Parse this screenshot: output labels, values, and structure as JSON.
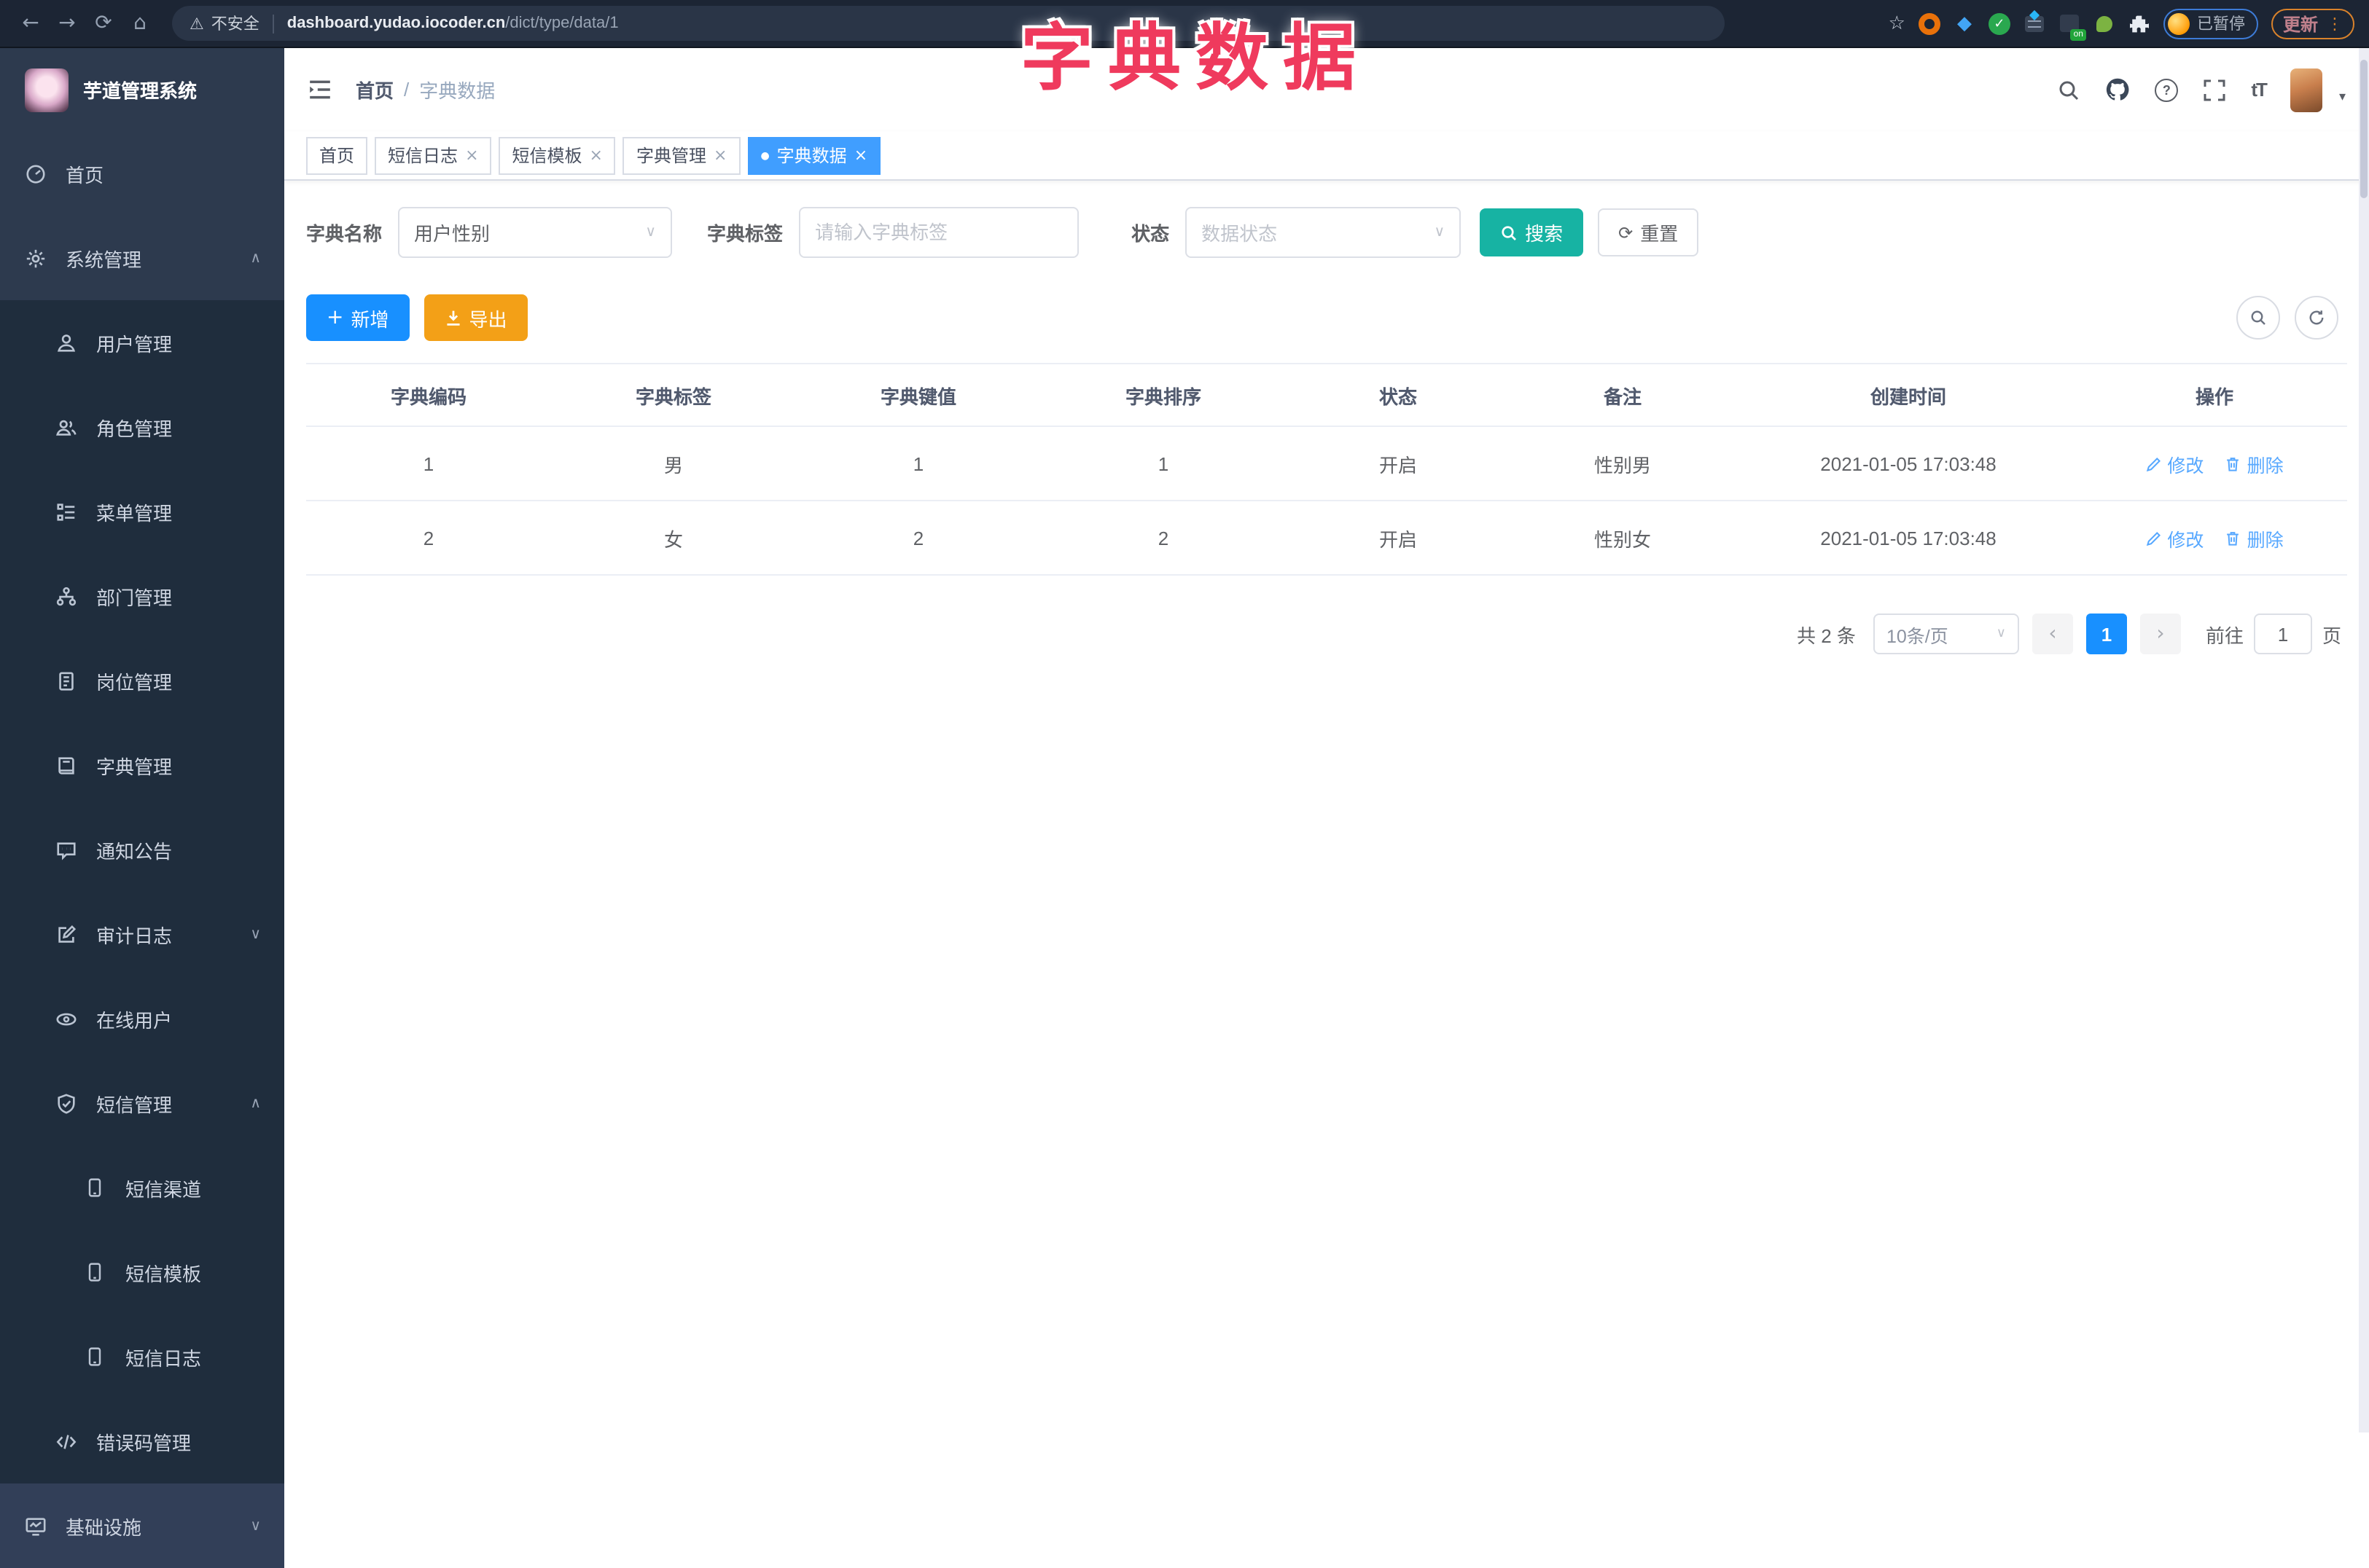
{
  "browser": {
    "security_warning": "不安全",
    "url_host": "dashboard.yudao.iocoder.cn",
    "url_path": "/dict/type/data/1",
    "paused_badge": "已暂停",
    "update_button": "更新",
    "on_badge": "on"
  },
  "overlay_title": "字典数据",
  "glyphs": {
    "back": "←",
    "forward": "→",
    "reload": "⟳",
    "home": "⌂",
    "warning": "⚠",
    "star": "☆",
    "menu_dots": "⋮",
    "close": "×",
    "active_dot": "●",
    "chevron_up": "∧",
    "chevron_down": "∨",
    "select_caret": "∨",
    "prev": "‹",
    "next": "›",
    "plus": "+",
    "refresh": "⟳",
    "caret_down": "▾",
    "question": "?",
    "font_size": "tT",
    "ext_check": "✓",
    "gem": "◆"
  },
  "sidebar": {
    "app_title": "芋道管理系统",
    "items": [
      {
        "label": "首页"
      },
      {
        "label": "系统管理"
      },
      {
        "label": "用户管理"
      },
      {
        "label": "角色管理"
      },
      {
        "label": "菜单管理"
      },
      {
        "label": "部门管理"
      },
      {
        "label": "岗位管理"
      },
      {
        "label": "字典管理"
      },
      {
        "label": "通知公告"
      },
      {
        "label": "审计日志"
      },
      {
        "label": "在线用户"
      },
      {
        "label": "短信管理"
      },
      {
        "label": "短信渠道"
      },
      {
        "label": "短信模板"
      },
      {
        "label": "短信日志"
      },
      {
        "label": "错误码管理"
      },
      {
        "label": "基础设施"
      }
    ]
  },
  "header": {
    "breadcrumb_home": "首页",
    "breadcrumb_separator": "/",
    "breadcrumb_current": "字典数据"
  },
  "tabs": [
    {
      "label": "首页"
    },
    {
      "label": "短信日志"
    },
    {
      "label": "短信模板"
    },
    {
      "label": "字典管理"
    },
    {
      "label": "字典数据"
    }
  ],
  "filters": {
    "name_label": "字典名称",
    "name_value": "用户性别",
    "tag_label": "字典标签",
    "tag_placeholder": "请输入字典标签",
    "status_label": "状态",
    "status_placeholder": "数据状态",
    "search_button": "搜索",
    "reset_button": "重置"
  },
  "toolbar": {
    "add_button": "新增",
    "export_button": "导出"
  },
  "table": {
    "columns": [
      "字典编码",
      "字典标签",
      "字典键值",
      "字典排序",
      "状态",
      "备注",
      "创建时间",
      "操作"
    ],
    "rows": [
      {
        "code": "1",
        "label": "男",
        "value": "1",
        "sort": "1",
        "status": "开启",
        "remark": "性别男",
        "created": "2021-01-05 17:03:48"
      },
      {
        "code": "2",
        "label": "女",
        "value": "2",
        "sort": "2",
        "status": "开启",
        "remark": "性别女",
        "created": "2021-01-05 17:03:48"
      }
    ],
    "edit_action": "修改",
    "delete_action": "删除"
  },
  "pagination": {
    "total": "共 2 条",
    "page_size": "10条/页",
    "current_page": "1",
    "goto_label": "前往",
    "goto_value": "1",
    "goto_unit": "页"
  },
  "colors": {
    "accent_blue": "#1890ff",
    "active_tab_blue": "#409eff",
    "search_teal": "#17b3a3",
    "export_orange": "#f3a017",
    "overlay_pink": "#ef3a5d",
    "sidebar_dark": "#1f2d3d",
    "sidebar_light": "#2d3a4e"
  }
}
